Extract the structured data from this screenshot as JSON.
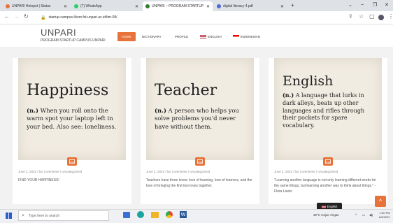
{
  "browser": {
    "tabs": [
      {
        "label": "UNPARI Hotspot | Status",
        "color": "#e8733a"
      },
      {
        "label": "(7) WhatsApp",
        "color": "#25d366"
      },
      {
        "label": "UNPARI – PROGRAM STARTUP",
        "color": "#2e7d32"
      },
      {
        "label": "digital literacy 4.pdf",
        "color": "#4a6cd4"
      }
    ],
    "new_tab": "+",
    "url": "startup-campus.ilkom.fst.unpari.ac.id/tim-09/"
  },
  "site": {
    "brand": "UNPARI",
    "tagline": "PROGRAM STARTUP CAMPUS UNPARI",
    "menu": {
      "home": "HOME",
      "dictionary": "DICTIONARY",
      "profile": "PROFILE",
      "english": "ENGLISH",
      "indonesian": "INDONESIAN"
    }
  },
  "posts": [
    {
      "title": "Happiness",
      "pos": "(n.)",
      "definition": "When you roll onto the warm spot your laptop left in your bed. Also see: loneliness.",
      "meta": "June 2, 2022  /  No Comments  /  Uncategorized",
      "excerpt": "FIND YOUR HAPPINESS!"
    },
    {
      "title": "Teacher",
      "pos": "(n.)",
      "definition": "A person who helps you solve problems you'd never have without them.",
      "meta": "June 2, 2022  /  No Comments  /  Uncategorized",
      "excerpt": "Teachers have three loves: love of learning, love of learners, and the love of bringing the first two loves together."
    },
    {
      "title": "English",
      "pos": "(n.)",
      "definition": "A language that lurks in dark alleys, beats up other languages and rifles through their pockets for spare vocabulary.",
      "meta": "June 2, 2022  /  No Comments  /  Uncategorized",
      "excerpt": "\"Learning another language is not only learning different words for the same things, but learning another way to think about things.\" - Flora Lewis"
    }
  ],
  "lang_chip": "English",
  "taskbar": {
    "search_placeholder": "Type here to search",
    "weather": "30°C  Hujan ringan",
    "time": "1:50 PM",
    "date": "6/6/2022"
  },
  "colors": {
    "accent": "#e8733a"
  }
}
